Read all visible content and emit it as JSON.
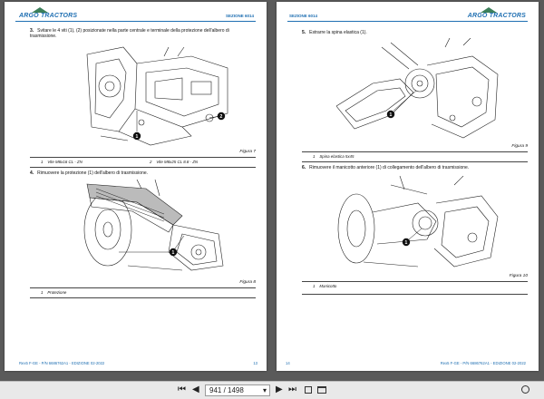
{
  "header": {
    "logo_text": "ARGO TRACTORS",
    "section_left": "SEZIONE 6014",
    "section_right": "SEZIONE 6014"
  },
  "left_page": {
    "step3": {
      "number": "3.",
      "text": "Svitare le 4 viti (1), (2) posizionate nella parte centrale e terminale della protezione dell'albero di trasmissione."
    },
    "figure7": {
      "caption": "Figura 7",
      "callouts": [
        "1",
        "2"
      ]
    },
    "legend7": [
      {
        "n": "1",
        "label": "Vite M8x16 CL - ZN"
      },
      {
        "n": "2",
        "label": "Vite M8x25 CL 8.8 - ZN"
      }
    ],
    "step4": {
      "number": "4.",
      "text": "Rimuovere la protezione (1) dell'albero di trasmissione."
    },
    "figure8": {
      "caption": "Figura 8",
      "callouts": [
        "1"
      ]
    },
    "legend8": [
      {
        "n": "1",
        "label": "Protezione"
      }
    ],
    "footer": "Rex5 F-GE - P/N 6686762A1 - EDIZIONE 02-2022",
    "page_number": "13"
  },
  "right_page": {
    "step5": {
      "number": "5.",
      "text": "Estrarre la spina elastica (1)."
    },
    "figure9": {
      "caption": "Figura 9",
      "callouts": [
        "1"
      ]
    },
    "legend9": [
      {
        "n": "1",
        "label": "Spina elastica 5x45"
      }
    ],
    "step6": {
      "number": "6.",
      "text": "Rimuovere il manicotto anteriore (1) di collegamento dell'albero di trasmissione."
    },
    "figure10": {
      "caption": "Figura 10",
      "callouts": [
        "1"
      ]
    },
    "legend10": [
      {
        "n": "1",
        "label": "Manicotto"
      }
    ],
    "footer": "Rex5 F-GE - P/N 6686762A1 - EDIZIONE 02-2022",
    "page_number": "14"
  },
  "toolbar": {
    "first": "⏮",
    "prev": "◀",
    "page_indicator": "941 / 1498",
    "dropdown": "▾",
    "next": "▶",
    "last": "⏭",
    "icons": [
      "fit-page-icon",
      "fit-width-icon",
      "zoom-icon"
    ],
    "colors": {
      "bar": "#e9e9e9",
      "accent": "#1f6fb2"
    }
  }
}
